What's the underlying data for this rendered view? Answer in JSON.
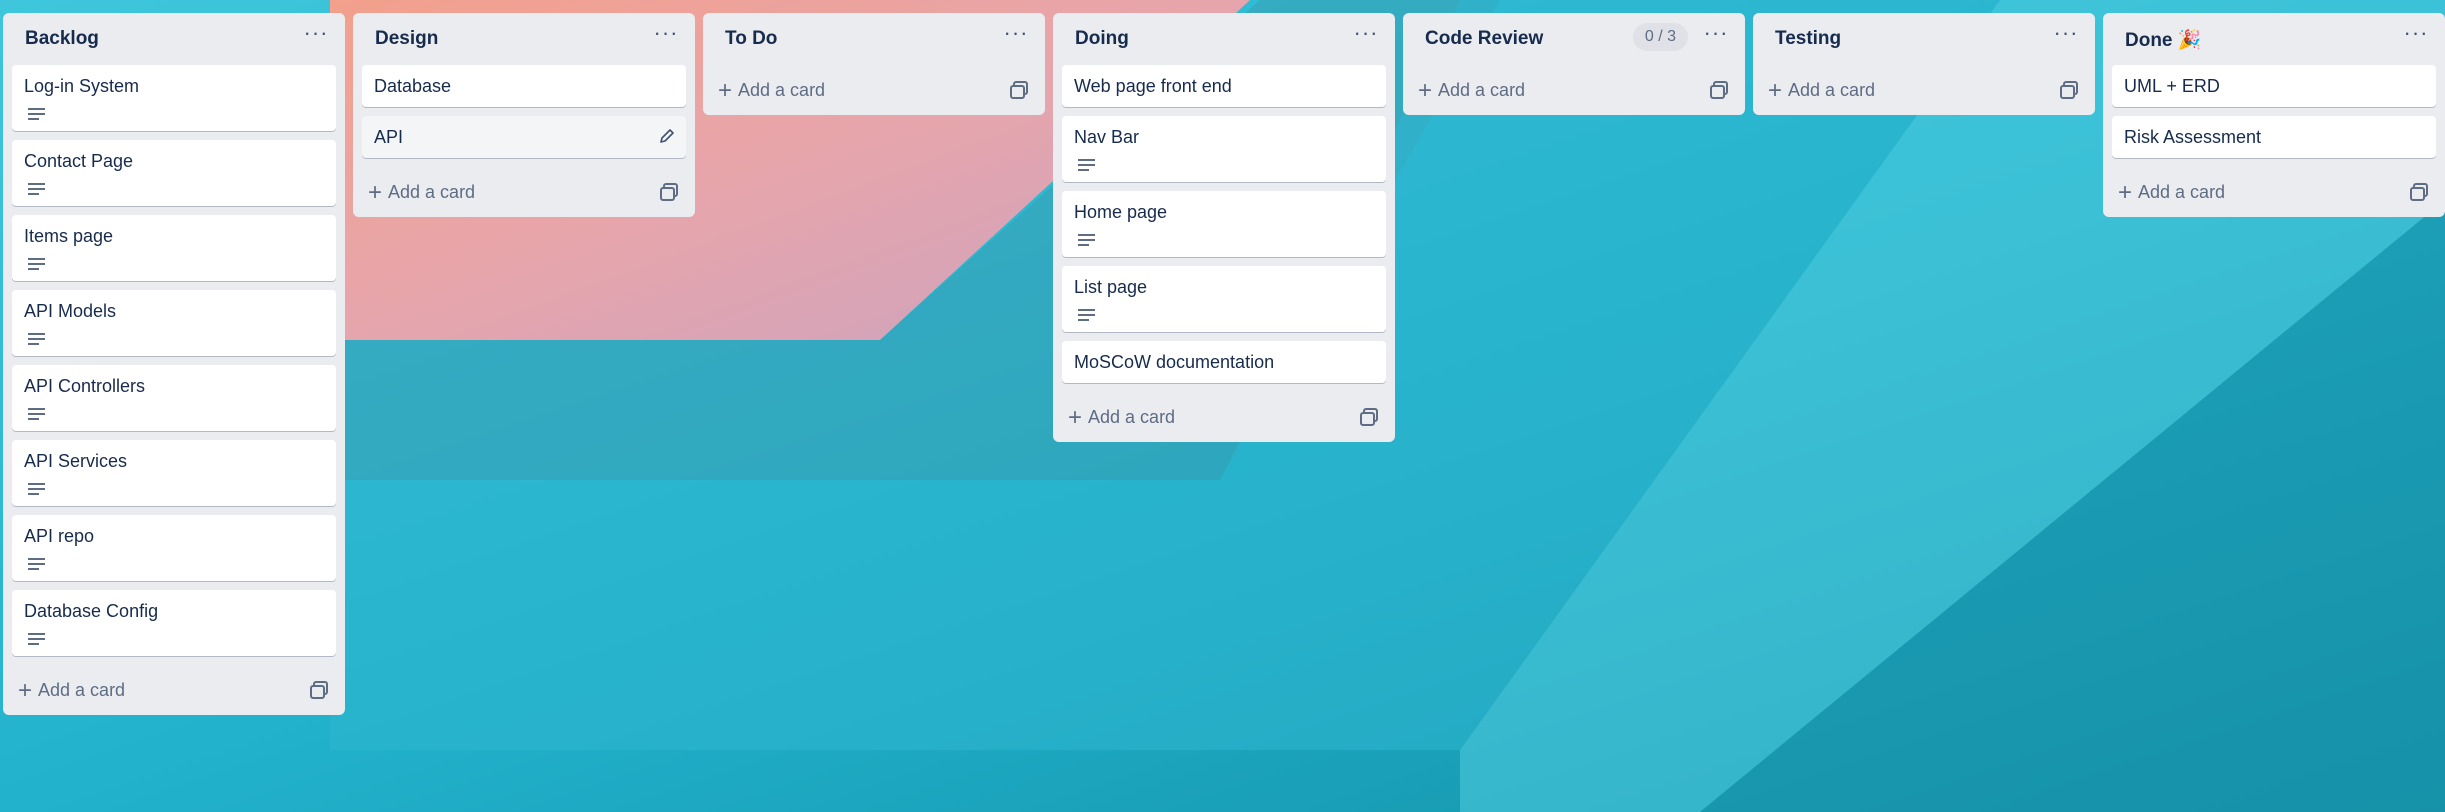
{
  "board": {
    "lists": [
      {
        "title": "Backlog",
        "cards": [
          {
            "title": "Log-in System",
            "has_description": true
          },
          {
            "title": "Contact Page",
            "has_description": true
          },
          {
            "title": "Items page",
            "has_description": true
          },
          {
            "title": "API Models",
            "has_description": true
          },
          {
            "title": "API Controllers",
            "has_description": true
          },
          {
            "title": "API Services",
            "has_description": true
          },
          {
            "title": "API repo",
            "has_description": true
          },
          {
            "title": "Database Config",
            "has_description": true
          }
        ],
        "add_card_label": "Add a card"
      },
      {
        "title": "Design",
        "cards": [
          {
            "title": "Database",
            "has_description": false
          },
          {
            "title": "API",
            "has_description": false,
            "hovered": true
          }
        ],
        "add_card_label": "Add a card"
      },
      {
        "title": "To Do",
        "cards": [],
        "add_card_label": "Add a card"
      },
      {
        "title": "Doing",
        "cards": [
          {
            "title": "Web page front end",
            "has_description": false
          },
          {
            "title": "Nav Bar",
            "has_description": true
          },
          {
            "title": "Home page",
            "has_description": true
          },
          {
            "title": "List page",
            "has_description": true
          },
          {
            "title": "MoSCoW documentation",
            "has_description": false
          }
        ],
        "add_card_label": "Add a card"
      },
      {
        "title": "Code Review",
        "limit_badge": "0 / 3",
        "cards": [],
        "add_card_label": "Add a card"
      },
      {
        "title": "Testing",
        "cards": [],
        "add_card_label": "Add a card"
      },
      {
        "title": "Done 🎉",
        "cards": [
          {
            "title": "UML + ERD",
            "has_description": false
          },
          {
            "title": "Risk Assessment",
            "has_description": false
          }
        ],
        "add_card_label": "Add a card"
      }
    ],
    "menu_glyph": "···",
    "plus_glyph": "+",
    "icons": {
      "list_menu": "more-horizontal-icon",
      "description": "description-lines-icon",
      "template": "card-template-icon",
      "edit": "pencil-icon"
    },
    "colors": {
      "list_bg": "#ebecf0",
      "card_bg": "#ffffff",
      "title_text": "#172b4d",
      "muted_text": "#5e6c84"
    }
  }
}
